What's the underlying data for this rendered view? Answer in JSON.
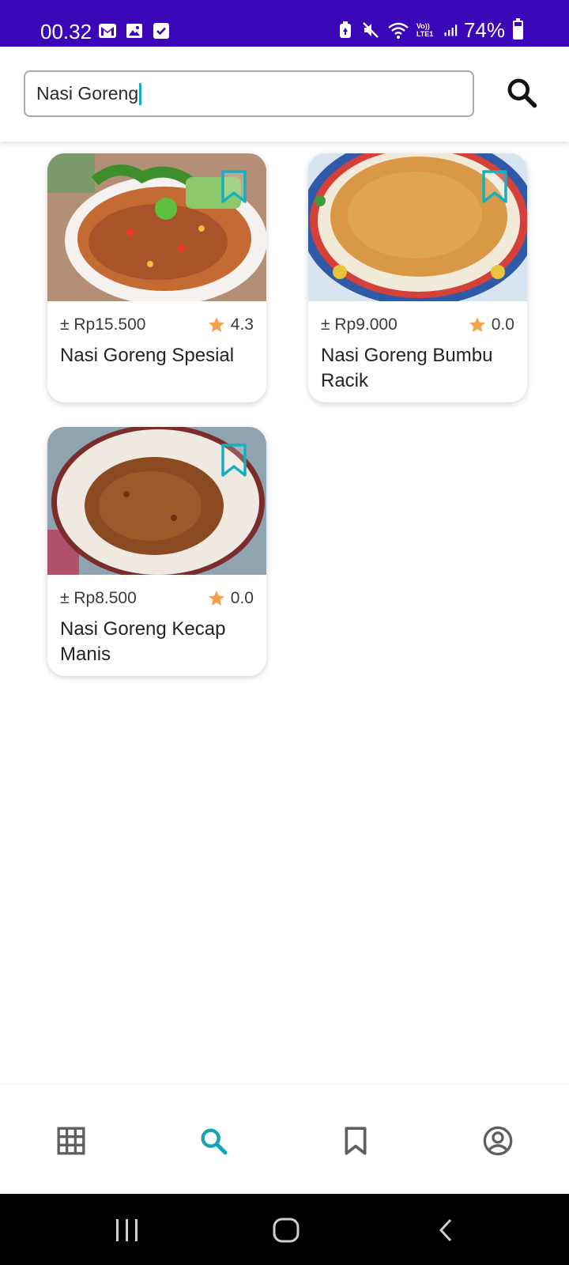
{
  "status_bar": {
    "time": "00.32",
    "battery_percent": "74%",
    "battery_level": 0.74,
    "left_icons": [
      "gmail-icon",
      "gallery-icon",
      "checkbox-icon"
    ],
    "right_icons": [
      "battery-saver-icon",
      "mute-icon",
      "wifi-icon",
      "volte-icon",
      "signal-icon",
      "battery-icon"
    ],
    "volte_label": "Vo)) LTE1",
    "background_color": "#3a06b8"
  },
  "search": {
    "query": "Nasi Goreng",
    "button_icon": "search-icon"
  },
  "results": [
    {
      "price": "± Rp15.500",
      "rating": "4.3",
      "title": "Nasi Goreng Spesial",
      "bookmark_icon": "bookmark-outline-icon"
    },
    {
      "price": "± Rp9.000",
      "rating": "0.0",
      "title": "Nasi Goreng Bumbu Racik",
      "bookmark_icon": "bookmark-outline-icon"
    },
    {
      "price": "± Rp8.500",
      "rating": "0.0",
      "title": "Nasi Goreng Kecap Manis",
      "bookmark_icon": "bookmark-outline-icon"
    }
  ],
  "bottom_nav": {
    "items": [
      {
        "icon": "grid-icon",
        "active": false
      },
      {
        "icon": "search-icon",
        "active": true
      },
      {
        "icon": "bookmark-icon",
        "active": false
      },
      {
        "icon": "account-icon",
        "active": false
      }
    ],
    "active_color": "#14a5b5",
    "inactive_color": "#5f5f5f"
  },
  "colors": {
    "accent": "#14b0bf",
    "star": "#f2a24a"
  }
}
